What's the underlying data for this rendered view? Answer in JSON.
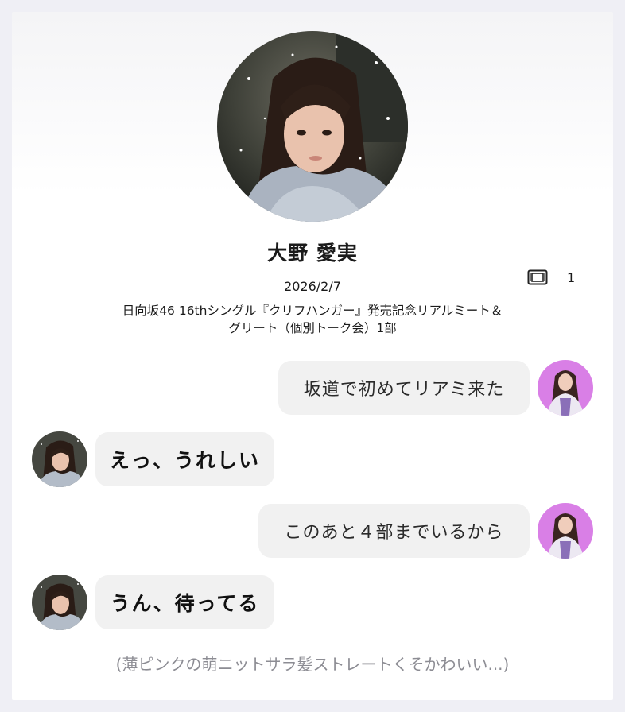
{
  "profile": {
    "name": "大野 愛実",
    "date": "2026/2/7",
    "ticket_count": "1",
    "event_line1": "日向坂46 16thシングル『クリフハンガー』発売記念リアルミート＆",
    "event_line2": "グリート（個別トーク会）1部"
  },
  "messages": [
    {
      "sender": "fan",
      "text": "坂道で初めてリアミ来た"
    },
    {
      "sender": "idol",
      "text": "えっ、うれしい"
    },
    {
      "sender": "fan",
      "text": "このあと４部までいるから"
    },
    {
      "sender": "idol",
      "text": "うん、待ってる"
    }
  ],
  "footer": {
    "note": "(薄ピンクの萌ニットサラ髪ストレートくそかわいい...)"
  },
  "colors": {
    "bubble": "#f1f1f1",
    "fan_avatar_bg": "#d97fe6",
    "note_text": "#8c8c93"
  },
  "icons": {
    "ticket": "ticket-icon"
  }
}
